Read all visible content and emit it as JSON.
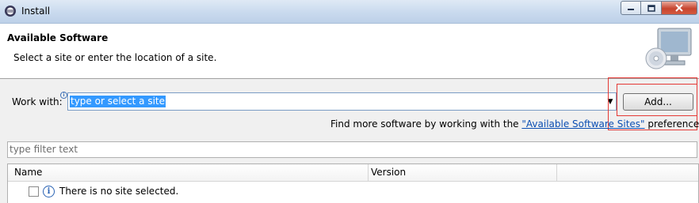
{
  "window": {
    "title": "Install",
    "icons": {
      "app": "eclipse-icon",
      "min": "minimize-icon",
      "max": "maximize-icon",
      "close": "close-icon"
    }
  },
  "header": {
    "title": "Available Software",
    "description": "Select a site or enter the location of a site.",
    "icon": "monitor-cd-icon"
  },
  "work_with": {
    "label": "Work with:",
    "value": "type or select a site",
    "add_button": "Add...",
    "more_prefix": "Find more software by working with the ",
    "more_link": "\"Available Software Sites\"",
    "more_suffix": " preferences."
  },
  "filter": {
    "placeholder": "type filter text"
  },
  "table": {
    "columns": [
      "Name",
      "Version"
    ],
    "rows": [
      {
        "name": "There is no site selected.",
        "checked": false
      }
    ]
  },
  "colors": {
    "selection": "#3399ff",
    "link": "#0b4fb3",
    "annotation": "#e53935"
  }
}
